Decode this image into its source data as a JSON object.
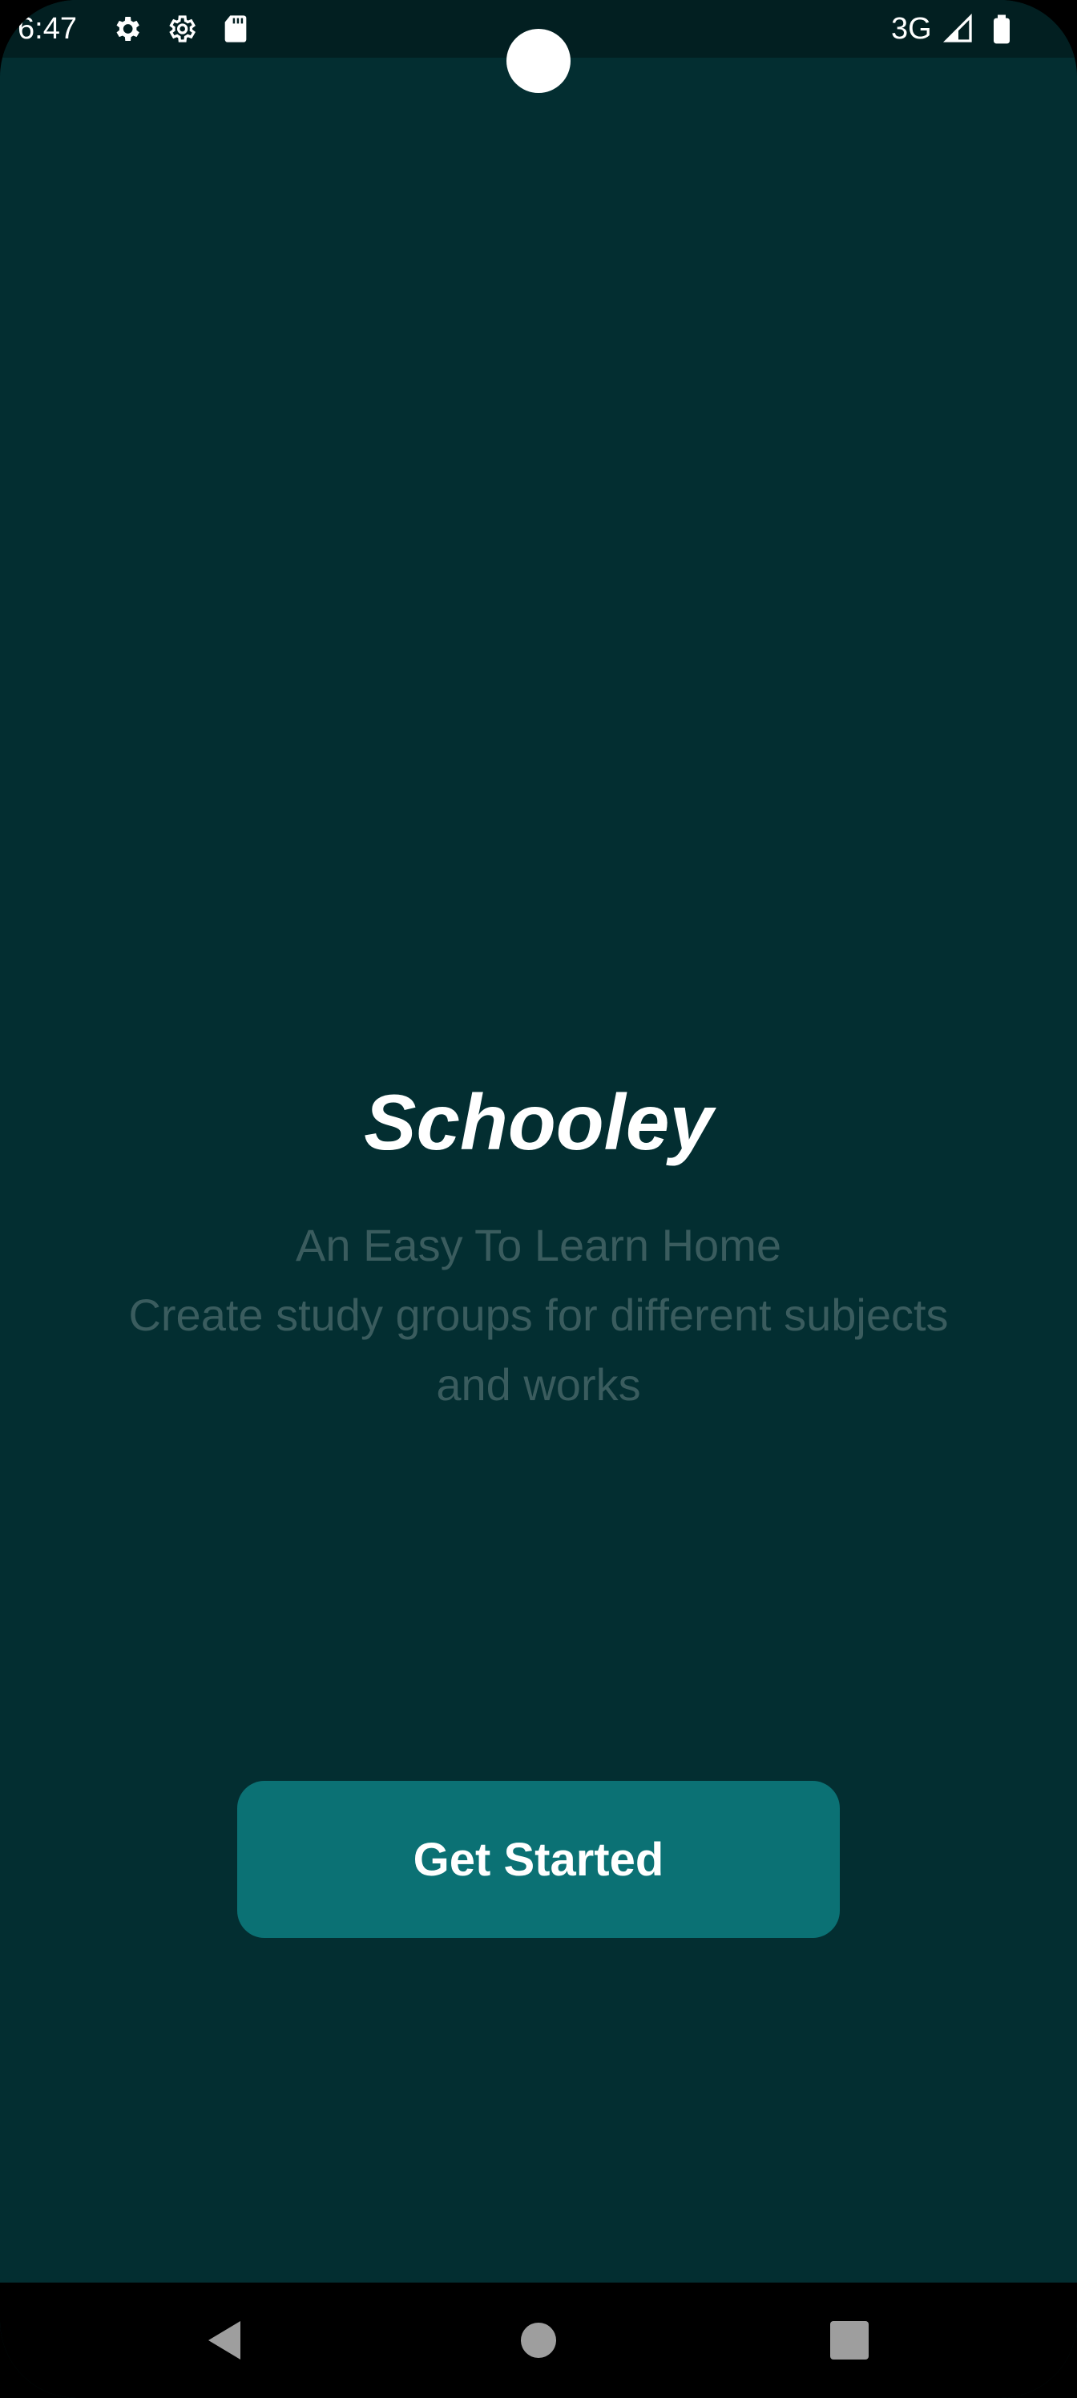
{
  "status_bar": {
    "time": "6:47",
    "network": "3G",
    "icons": [
      "settings-gear-filled-icon",
      "settings-gear-outline-icon",
      "sd-card-icon",
      "cell-signal-icon",
      "battery-icon"
    ]
  },
  "main": {
    "title": "Schooley",
    "tagline_lines": [
      "An Easy To Learn Home",
      "Create study groups for different subjects",
      "and works"
    ],
    "cta_label": "Get Started"
  },
  "nav_bar": {
    "buttons": [
      "back-icon",
      "home-icon",
      "recents-icon"
    ]
  },
  "colors": {
    "background": "#032e31",
    "status_bar": "#021f21",
    "title": "#ffffff",
    "tagline": "#3a5c5e",
    "button": "#0b7174",
    "button_text": "#ffffff"
  }
}
